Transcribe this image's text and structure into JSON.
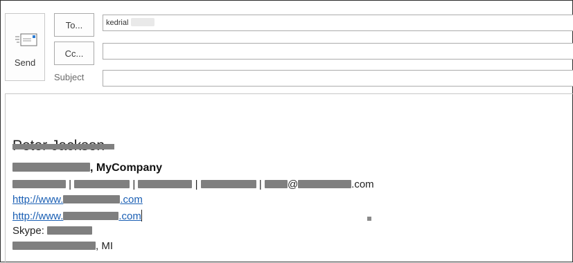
{
  "toolbar": {
    "send_label": "Send",
    "send_icon": "send-mail-icon"
  },
  "fields": {
    "to_label": "To...",
    "cc_label": "Cc...",
    "subject_label": "Subject",
    "to_value": "kedrial",
    "cc_value": "",
    "subject_value": ""
  },
  "signature": {
    "name_visible": "Peter Jackson",
    "title_tail": ", MyCompany",
    "email_domain_prefix": "@",
    "email_tail": ".com",
    "url_prefix": "http://www.",
    "url_suffix": ".com",
    "skype_label": "Skype: ",
    "location_tail": ", MI"
  },
  "colors": {
    "link": "#1a5fb4",
    "redaction": "#808080"
  }
}
